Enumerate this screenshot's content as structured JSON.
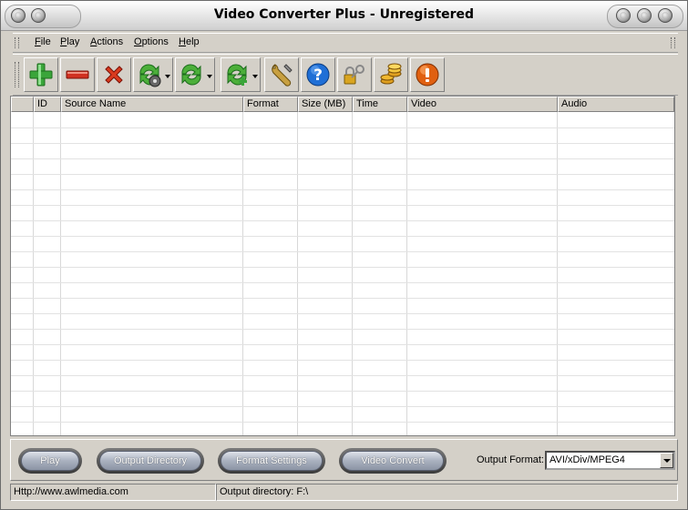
{
  "window": {
    "title": "Video Converter Plus - Unregistered"
  },
  "menu": [
    {
      "label": "File"
    },
    {
      "label": "Play"
    },
    {
      "label": "Actions"
    },
    {
      "label": "Options"
    },
    {
      "label": "Help"
    }
  ],
  "toolbar": [
    {
      "icon": "add-icon"
    },
    {
      "icon": "remove-icon"
    },
    {
      "icon": "delete-icon"
    },
    {
      "icon": "convert-video-icon"
    },
    {
      "icon": "convert-icon"
    },
    {
      "icon": "convert-add-icon"
    },
    {
      "icon": "settings-wrench-icon"
    },
    {
      "icon": "help-icon"
    },
    {
      "icon": "register-key-icon"
    },
    {
      "icon": "buy-coins-icon"
    },
    {
      "icon": "info-icon"
    }
  ],
  "table": {
    "columns": [
      "",
      "ID",
      "Source Name",
      "Format",
      "Size (MB)",
      "Time",
      "Video",
      "Audio"
    ],
    "rows": []
  },
  "bottom": {
    "play_label": "Play",
    "output_dir_label": "Output Directory",
    "format_settings_label": "Format Settings",
    "video_convert_label": "Video Convert",
    "output_format_label": "Output Format:",
    "output_format_value": "AVI/xDiv/MPEG4"
  },
  "status": {
    "url": "Http://www.awlmedia.com",
    "output_directory": "Output directory: F:\\"
  },
  "colors": {
    "window_bg": "#d4d0c8",
    "green": "#3aa53a",
    "red": "#d03020",
    "blue": "#1f6fd6",
    "orange": "#e06010"
  }
}
